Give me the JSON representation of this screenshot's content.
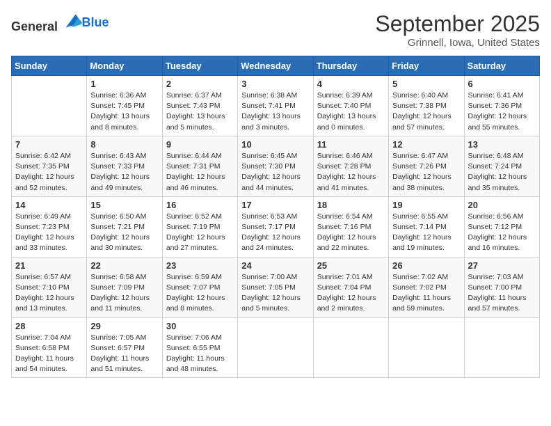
{
  "logo": {
    "text_general": "General",
    "text_blue": "Blue"
  },
  "title": "September 2025",
  "location": "Grinnell, Iowa, United States",
  "days_of_week": [
    "Sunday",
    "Monday",
    "Tuesday",
    "Wednesday",
    "Thursday",
    "Friday",
    "Saturday"
  ],
  "weeks": [
    [
      {
        "day": "",
        "info": ""
      },
      {
        "day": "1",
        "info": "Sunrise: 6:36 AM\nSunset: 7:45 PM\nDaylight: 13 hours\nand 8 minutes."
      },
      {
        "day": "2",
        "info": "Sunrise: 6:37 AM\nSunset: 7:43 PM\nDaylight: 13 hours\nand 5 minutes."
      },
      {
        "day": "3",
        "info": "Sunrise: 6:38 AM\nSunset: 7:41 PM\nDaylight: 13 hours\nand 3 minutes."
      },
      {
        "day": "4",
        "info": "Sunrise: 6:39 AM\nSunset: 7:40 PM\nDaylight: 13 hours\nand 0 minutes."
      },
      {
        "day": "5",
        "info": "Sunrise: 6:40 AM\nSunset: 7:38 PM\nDaylight: 12 hours\nand 57 minutes."
      },
      {
        "day": "6",
        "info": "Sunrise: 6:41 AM\nSunset: 7:36 PM\nDaylight: 12 hours\nand 55 minutes."
      }
    ],
    [
      {
        "day": "7",
        "info": "Sunrise: 6:42 AM\nSunset: 7:35 PM\nDaylight: 12 hours\nand 52 minutes."
      },
      {
        "day": "8",
        "info": "Sunrise: 6:43 AM\nSunset: 7:33 PM\nDaylight: 12 hours\nand 49 minutes."
      },
      {
        "day": "9",
        "info": "Sunrise: 6:44 AM\nSunset: 7:31 PM\nDaylight: 12 hours\nand 46 minutes."
      },
      {
        "day": "10",
        "info": "Sunrise: 6:45 AM\nSunset: 7:30 PM\nDaylight: 12 hours\nand 44 minutes."
      },
      {
        "day": "11",
        "info": "Sunrise: 6:46 AM\nSunset: 7:28 PM\nDaylight: 12 hours\nand 41 minutes."
      },
      {
        "day": "12",
        "info": "Sunrise: 6:47 AM\nSunset: 7:26 PM\nDaylight: 12 hours\nand 38 minutes."
      },
      {
        "day": "13",
        "info": "Sunrise: 6:48 AM\nSunset: 7:24 PM\nDaylight: 12 hours\nand 35 minutes."
      }
    ],
    [
      {
        "day": "14",
        "info": "Sunrise: 6:49 AM\nSunset: 7:23 PM\nDaylight: 12 hours\nand 33 minutes."
      },
      {
        "day": "15",
        "info": "Sunrise: 6:50 AM\nSunset: 7:21 PM\nDaylight: 12 hours\nand 30 minutes."
      },
      {
        "day": "16",
        "info": "Sunrise: 6:52 AM\nSunset: 7:19 PM\nDaylight: 12 hours\nand 27 minutes."
      },
      {
        "day": "17",
        "info": "Sunrise: 6:53 AM\nSunset: 7:17 PM\nDaylight: 12 hours\nand 24 minutes."
      },
      {
        "day": "18",
        "info": "Sunrise: 6:54 AM\nSunset: 7:16 PM\nDaylight: 12 hours\nand 22 minutes."
      },
      {
        "day": "19",
        "info": "Sunrise: 6:55 AM\nSunset: 7:14 PM\nDaylight: 12 hours\nand 19 minutes."
      },
      {
        "day": "20",
        "info": "Sunrise: 6:56 AM\nSunset: 7:12 PM\nDaylight: 12 hours\nand 16 minutes."
      }
    ],
    [
      {
        "day": "21",
        "info": "Sunrise: 6:57 AM\nSunset: 7:10 PM\nDaylight: 12 hours\nand 13 minutes."
      },
      {
        "day": "22",
        "info": "Sunrise: 6:58 AM\nSunset: 7:09 PM\nDaylight: 12 hours\nand 11 minutes."
      },
      {
        "day": "23",
        "info": "Sunrise: 6:59 AM\nSunset: 7:07 PM\nDaylight: 12 hours\nand 8 minutes."
      },
      {
        "day": "24",
        "info": "Sunrise: 7:00 AM\nSunset: 7:05 PM\nDaylight: 12 hours\nand 5 minutes."
      },
      {
        "day": "25",
        "info": "Sunrise: 7:01 AM\nSunset: 7:04 PM\nDaylight: 12 hours\nand 2 minutes."
      },
      {
        "day": "26",
        "info": "Sunrise: 7:02 AM\nSunset: 7:02 PM\nDaylight: 11 hours\nand 59 minutes."
      },
      {
        "day": "27",
        "info": "Sunrise: 7:03 AM\nSunset: 7:00 PM\nDaylight: 11 hours\nand 57 minutes."
      }
    ],
    [
      {
        "day": "28",
        "info": "Sunrise: 7:04 AM\nSunset: 6:58 PM\nDaylight: 11 hours\nand 54 minutes."
      },
      {
        "day": "29",
        "info": "Sunrise: 7:05 AM\nSunset: 6:57 PM\nDaylight: 11 hours\nand 51 minutes."
      },
      {
        "day": "30",
        "info": "Sunrise: 7:06 AM\nSunset: 6:55 PM\nDaylight: 11 hours\nand 48 minutes."
      },
      {
        "day": "",
        "info": ""
      },
      {
        "day": "",
        "info": ""
      },
      {
        "day": "",
        "info": ""
      },
      {
        "day": "",
        "info": ""
      }
    ]
  ]
}
